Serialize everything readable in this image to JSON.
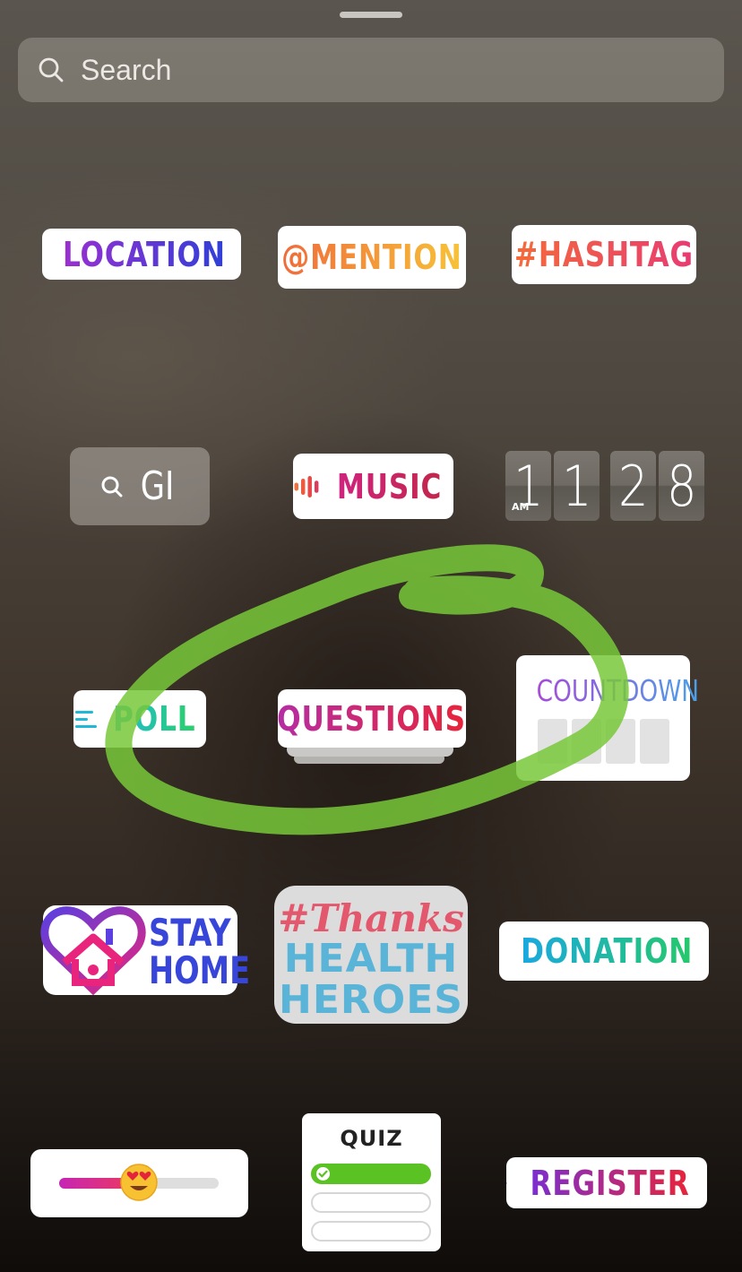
{
  "search": {
    "placeholder": "Search"
  },
  "stickers": {
    "location": "LOCATION",
    "mention": "@MENTION",
    "hashtag": "#HASHTAG",
    "gif": "GI",
    "music": "MUSIC",
    "clock": {
      "digits": [
        "1",
        "1",
        "2",
        "8"
      ],
      "ampm": "AM"
    },
    "poll": "POLL",
    "questions": "QUESTIONS",
    "countdown": "COUNTDOWN",
    "stay_home": [
      "STAY",
      "HOME"
    ],
    "thanks": {
      "line1": "#Thanks",
      "line2": "HEALTH",
      "line3": "HEROES"
    },
    "donation": "DONATION",
    "emoji_slider": {
      "emoji": "😍",
      "level": 0.5
    },
    "quiz": {
      "title": "QUIZ"
    },
    "register": "REGISTER"
  },
  "colors": {
    "annotation_stroke": "#78c83a"
  }
}
